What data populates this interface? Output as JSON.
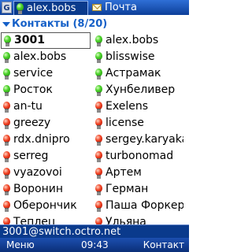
{
  "tabs": {
    "shortcut": "G",
    "active": {
      "label": "alex.bobs",
      "icon": "green-bulb-icon"
    },
    "inactive": {
      "label": "Почта",
      "icon": "envelope-icon"
    }
  },
  "group": {
    "label": "Контакты (8/20)"
  },
  "contacts_left": [
    {
      "name": "3001",
      "status": "online"
    },
    {
      "name": "alex.bobs",
      "status": "online"
    },
    {
      "name": "service",
      "status": "online"
    },
    {
      "name": "Росток",
      "status": "online"
    },
    {
      "name": "an-tu",
      "status": "offline"
    },
    {
      "name": "greezy",
      "status": "offline"
    },
    {
      "name": "rdx.dnipro",
      "status": "offline"
    },
    {
      "name": "serreg",
      "status": "offline"
    },
    {
      "name": "vyazovoi",
      "status": "offline"
    },
    {
      "name": "Воронин",
      "status": "offline"
    },
    {
      "name": "Оберончик",
      "status": "offline"
    },
    {
      "name": "Теплец",
      "status": "offline"
    }
  ],
  "contacts_right": [
    {
      "name": "alex.bobs",
      "status": "online"
    },
    {
      "name": "blisswise",
      "status": "online"
    },
    {
      "name": "Астрамак",
      "status": "online"
    },
    {
      "name": "Хунбеливер",
      "status": "online"
    },
    {
      "name": "Exelens",
      "status": "offline"
    },
    {
      "name": "license",
      "status": "offline"
    },
    {
      "name": "sergey.karyaka",
      "status": "offline"
    },
    {
      "name": "turbonomad",
      "status": "offline"
    },
    {
      "name": "Артем",
      "status": "offline"
    },
    {
      "name": "Герман",
      "status": "offline"
    },
    {
      "name": "Паша Форкерт",
      "status": "offline"
    },
    {
      "name": "Ульяна",
      "status": "offline"
    }
  ],
  "status_text": "3001@switch.octro.net",
  "softkeys": {
    "left": "Меню",
    "time": "09:43",
    "right": "Контакт"
  },
  "colors": {
    "accent": "#0a3a8c",
    "group_header": "#1560c8",
    "online": "#4cd22a",
    "offline": "#f04020"
  }
}
